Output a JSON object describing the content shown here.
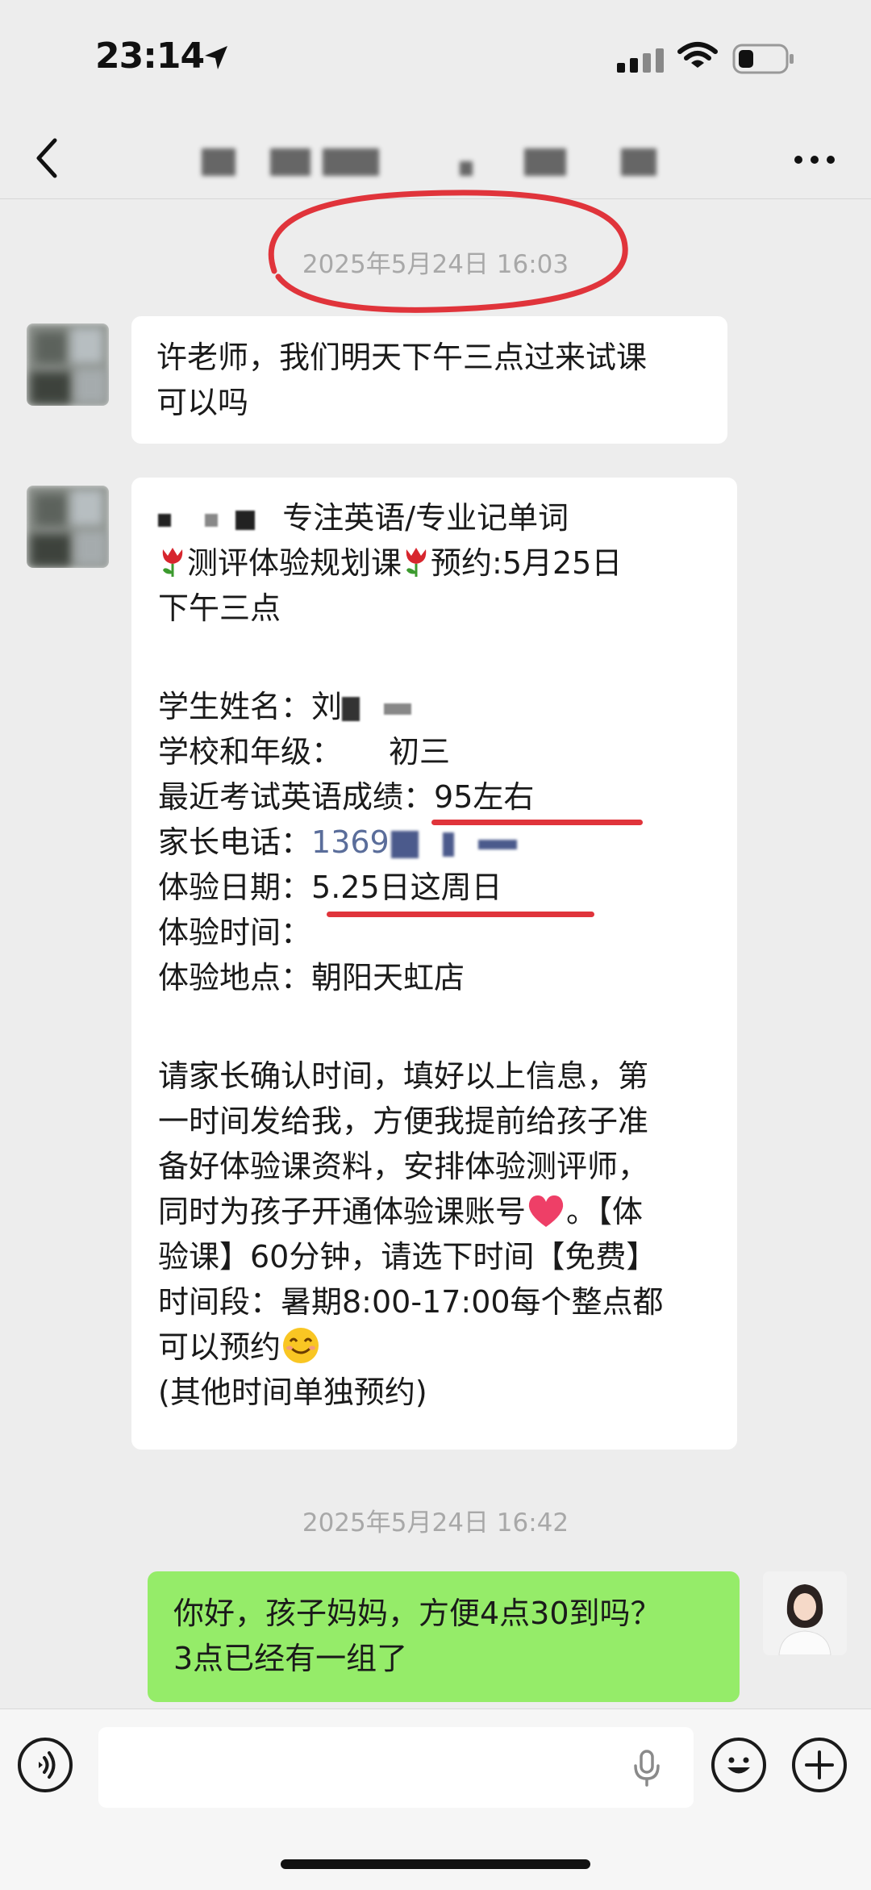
{
  "status": {
    "time": "23:14"
  },
  "chat": {
    "timestamp1": "2025年5月24日 16:03",
    "msg1": "许老师，我们明天下午三点过来试课\n可以吗",
    "msg2": {
      "line1": "专注英语/专业记单词",
      "line2a": "测评体验规划课",
      "line2b": "预约:5月25日",
      "line3": "下午三点",
      "name_label": "学生姓名：刘",
      "school_label": "学校和年级：",
      "school_value": "初三",
      "score_label": "最近考试英语成绩：",
      "score_value": "95左右",
      "phone_label": "家长电话：",
      "phone_value": "1369",
      "date_label": "体验日期：",
      "date_value": "5.25日这周日",
      "time_label": "体验时间：",
      "place_label": "体验地点：",
      "place_value": "朝阳天虹店",
      "para1": "请家长确认时间，填好以上信息，第",
      "para2": "一时间发给我，方便我提前给孩子准",
      "para3": "备好体验课资料，安排体验测评师，",
      "para4": "同时为孩子开通体验课账号",
      "para4b": "。【体",
      "para5": "验课】60分钟，请选下时间【免费】",
      "para6": "时间段：暑期8:00-17:00每个整点都",
      "para7": "可以预约",
      "para8": "(其他时间单独预约)"
    },
    "timestamp2": "2025年5月24日 16:42",
    "msg3": "你好，孩子妈妈，方便4点30到吗？\n3点已经有一组了"
  },
  "icons": {
    "location": "location-arrow-icon",
    "signal": "signal-icon",
    "wifi": "wifi-icon",
    "battery": "battery-icon",
    "back": "back-chevron-icon",
    "more": "more-icon",
    "voice": "voice-icon",
    "mic": "microphone-icon",
    "emoji": "emoji-icon",
    "plus": "plus-icon",
    "tulip": "tulip-icon",
    "heart": "heart-icon",
    "smile": "smile-icon"
  },
  "colors": {
    "bubble_green": "#95ec69",
    "underline_red": "#e0343b",
    "background": "#ededed"
  }
}
